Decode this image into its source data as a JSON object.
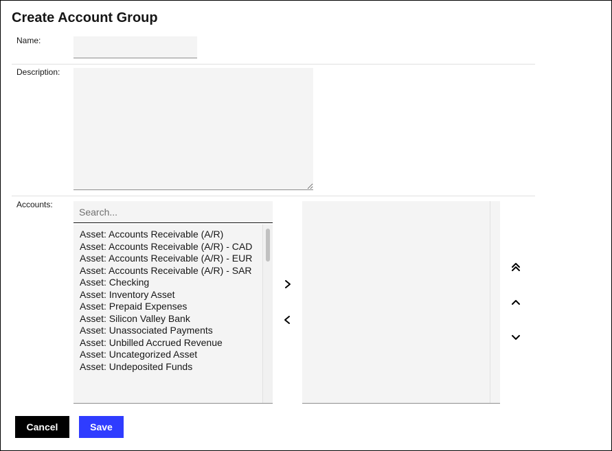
{
  "dialog": {
    "title": "Create Account Group"
  },
  "form": {
    "name_label": "Name:",
    "name_value": "",
    "description_label": "Description:",
    "description_value": "",
    "accounts_label": "Accounts:"
  },
  "accounts": {
    "search_placeholder": "Search...",
    "available": [
      "Asset: Accounts Receivable (A/R)",
      "Asset: Accounts Receivable (A/R) - CAD",
      "Asset: Accounts Receivable (A/R) - EUR",
      "Asset: Accounts Receivable (A/R) - SAR",
      "Asset: Checking",
      "Asset: Inventory Asset",
      "Asset: Prepaid Expenses",
      "Asset: Silicon Valley Bank",
      "Asset: Unassociated Payments",
      "Asset: Unbilled Accrued Revenue",
      "Asset: Uncategorized Asset",
      "Asset: Undeposited Funds"
    ],
    "selected": []
  },
  "icons": {
    "move_right": "chevron-right-icon",
    "move_left": "chevron-left-icon",
    "move_top": "double-chevron-up-icon",
    "move_up": "chevron-up-icon",
    "move_down": "chevron-down-icon"
  },
  "buttons": {
    "cancel": "Cancel",
    "save": "Save"
  },
  "colors": {
    "save_button": "#2f3cff",
    "cancel_button": "#000000",
    "field_background": "#f4f4f4"
  }
}
